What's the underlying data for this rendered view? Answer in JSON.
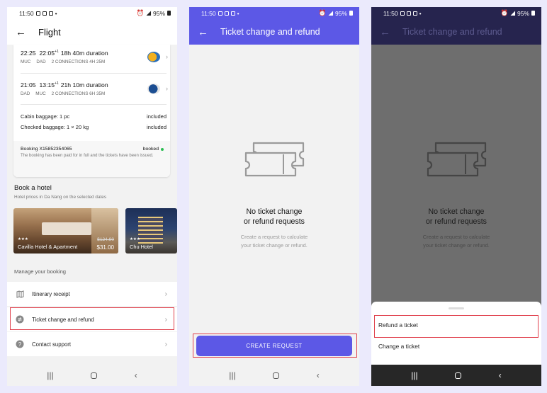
{
  "status_bar": {
    "time": "11:50",
    "battery": "95%"
  },
  "screen1": {
    "title": "Flight",
    "flights": [
      {
        "dep": "22:25",
        "arr": "22:05",
        "plus": "+1",
        "duration": "18h 40m duration",
        "from": "MUC",
        "to": "DAD",
        "connections": "2 CONNECTIONS 4H 25M"
      },
      {
        "dep": "21:05",
        "arr": "13:15",
        "plus": "+1",
        "duration": "21h 10m duration",
        "from": "DAD",
        "to": "MUC",
        "connections": "2 CONNECTIONS 6H 35M"
      }
    ],
    "baggage": [
      {
        "label": "Cabin baggage: 1 pc",
        "value": "included"
      },
      {
        "label": "Checked baggage: 1 × 20 kg",
        "value": "included"
      }
    ],
    "booking": {
      "id": "Booking X15852354065",
      "status": "booked",
      "note": "The booking has been paid for in full and the tickets have been issued."
    },
    "hotel_section": {
      "title": "Book a hotel",
      "subtitle": "Hotel prices in Da Nang on the selected dates"
    },
    "hotels": [
      {
        "name": "Cavilla Hotel & Apartment",
        "stars": "★★★",
        "old_price": "$124.90",
        "price": "$31.00"
      },
      {
        "name": "Chu Hotel",
        "stars": "★★★"
      }
    ],
    "manage_label": "Manage your booking",
    "menu": [
      {
        "label": "Itinerary receipt",
        "icon": "map-icon"
      },
      {
        "label": "Ticket change and refund",
        "icon": "exchange-icon"
      },
      {
        "label": "Contact support",
        "icon": "help-icon"
      }
    ]
  },
  "screen2": {
    "title": "Ticket change and refund",
    "empty_title_line1": "No ticket change",
    "empty_title_line2": "or refund requests",
    "empty_sub_line1": "Create a request to calculate",
    "empty_sub_line2": "your ticket change or refund.",
    "cta": "CREATE REQUEST"
  },
  "screen3": {
    "title": "Ticket change and refund",
    "sheet_items": [
      "Refund a ticket",
      "Change a ticket"
    ]
  },
  "colors": {
    "accent": "#5c58e6",
    "highlight": "#e0414d",
    "booked": "#2bbd52"
  }
}
